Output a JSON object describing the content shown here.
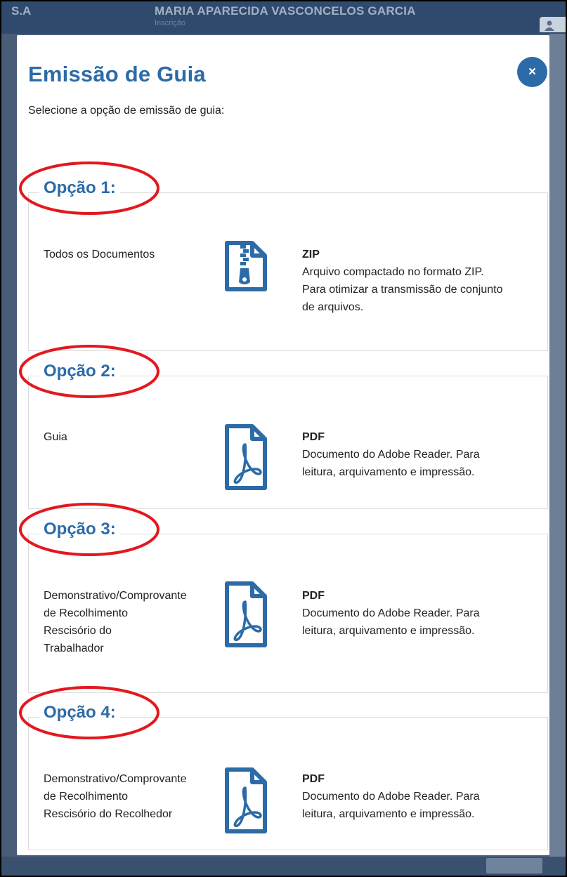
{
  "background_app": {
    "company_suffix": "S.A",
    "employee_name": "MARIA APARECIDA VASCONCELOS GARCIA",
    "employee_sublabel": "Inscrição"
  },
  "modal": {
    "title": "Emissão de Guia",
    "subtitle": "Selecione a opção de emissão de guia:",
    "close_label": "×",
    "accent_color": "#2c6ba7",
    "highlight_color": "#e3181f"
  },
  "options": [
    {
      "legend": "Opção 1:",
      "label_lines": [
        "Todos os Documentos"
      ],
      "icon": "zip-file-icon",
      "format": "ZIP",
      "description_lines": [
        "Arquivo compactado no formato ZIP.",
        "Para otimizar a transmissão de conjunto",
        "de arquivos."
      ]
    },
    {
      "legend": "Opção 2:",
      "label_lines": [
        "Guia"
      ],
      "icon": "pdf-file-icon",
      "format": "PDF",
      "description_lines": [
        "Documento do Adobe Reader. Para",
        "leitura, arquivamento e impressão."
      ]
    },
    {
      "legend": "Opção 3:",
      "label_lines": [
        "Demonstrativo/Comprovante",
        "de Recolhimento",
        "Rescisório do",
        "Trabalhador"
      ],
      "icon": "pdf-file-icon",
      "format": "PDF",
      "description_lines": [
        "Documento do Adobe Reader. Para",
        "leitura, arquivamento e impressão."
      ]
    },
    {
      "legend": "Opção 4:",
      "label_lines": [
        "Demonstrativo/Comprovante",
        "de Recolhimento",
        "Rescisório do Recolhedor"
      ],
      "icon": "pdf-file-icon",
      "format": "PDF",
      "description_lines": [
        "Documento do Adobe Reader. Para",
        "leitura, arquivamento e impressão."
      ]
    }
  ]
}
